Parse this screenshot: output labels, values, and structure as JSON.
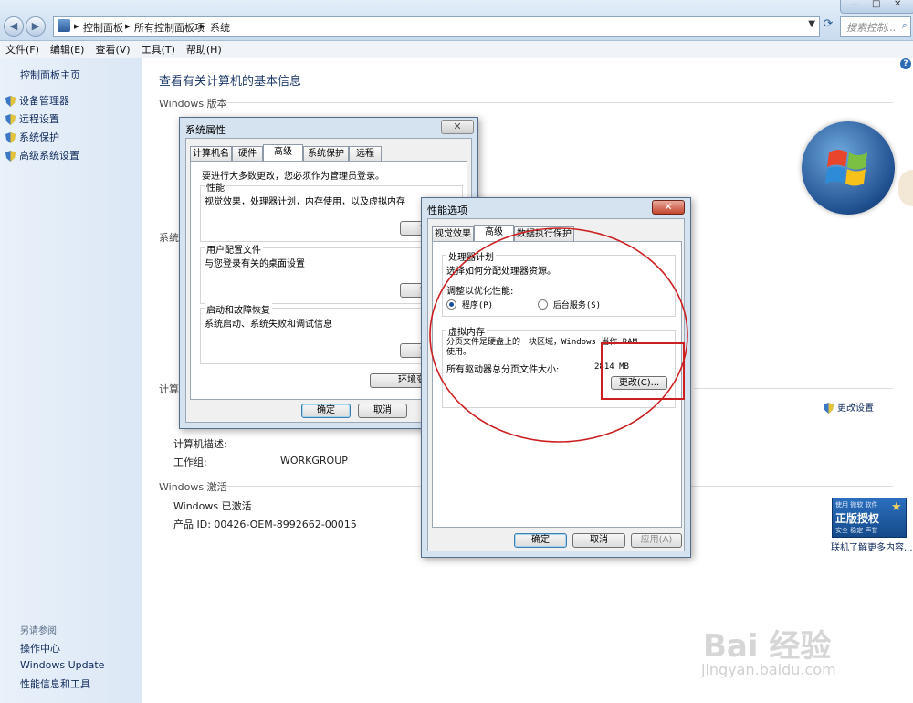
{
  "addressbar": {
    "breadcrumb": [
      "控制面板",
      "所有控制面板项",
      "系统"
    ],
    "separator": "▸",
    "search_placeholder": "搜索控制..."
  },
  "menubar": [
    "文件(F)",
    "编辑(E)",
    "查看(V)",
    "工具(T)",
    "帮助(H)"
  ],
  "sidebar": {
    "home": "控制面板主页",
    "items": [
      {
        "label": "设备管理器",
        "icon": "shield-icon"
      },
      {
        "label": "远程设置",
        "icon": "shield-icon"
      },
      {
        "label": "系统保护",
        "icon": "shield-icon"
      },
      {
        "label": "高级系统设置",
        "icon": "shield-icon"
      }
    ],
    "see_also_header": "另请参阅",
    "see_also": [
      "操作中心",
      "Windows Update",
      "性能信息和工具"
    ]
  },
  "main": {
    "title": "查看有关计算机的基本信息",
    "edition_header": "Windows 版本",
    "system_header": "系统",
    "computer_header": "计算",
    "computer_desc_label": "计算机描述:",
    "workgroup_label": "工作组:",
    "workgroup_value": "WORKGROUP",
    "change_settings": "更改设置",
    "activation_header": "Windows 激活",
    "activated": "Windows 已激活",
    "product_id": "产品 ID: 00426-OEM-8992662-00015",
    "genuine_badge": {
      "line1": "使用 微软 软件",
      "line2": "正版授权",
      "line3": "安全 稳定 声誉"
    },
    "genuine_link": "联机了解更多内容..."
  },
  "sysprops": {
    "title": "系统属性",
    "tabs": [
      "计算机名",
      "硬件",
      "高级",
      "系统保护",
      "远程"
    ],
    "active_tab": "高级",
    "admin_note": "要进行大多数更改，您必须作为管理员登录。",
    "perf_group": "性能",
    "perf_desc": "视觉效果，处理器计划，内存使用，以及虚拟内存",
    "profile_group": "用户配置文件",
    "profile_desc": "与您登录有关的桌面设置",
    "startup_group": "启动和故障恢复",
    "startup_desc": "系统启动、系统失败和调试信息",
    "settings_btn": "设置",
    "env_btn": "环境变量",
    "ok": "确定",
    "cancel": "取消"
  },
  "perfopts": {
    "title": "性能选项",
    "tabs": [
      "视觉效果",
      "高级",
      "数据执行保护"
    ],
    "active_tab": "高级",
    "cpu_group": "处理器计划",
    "cpu_desc": "选择如何分配处理器资源。",
    "adjust_label": "调整以优化性能:",
    "radio_programs": "程序(P)",
    "radio_background": "后台服务(S)",
    "vm_group": "虚拟内存",
    "vm_desc": "分页文件是硬盘上的一块区域，Windows 当作 RAM 使用。",
    "vm_total_label": "所有驱动器总分页文件大小:",
    "vm_total_value": "2814 MB",
    "change_btn": "更改(C)...",
    "ok": "确定",
    "cancel": "取消",
    "apply": "应用(A)"
  },
  "watermark": {
    "brand": "Bai 经验",
    "url": "jingyan.baidu.com"
  },
  "colors": {
    "annotation_red": "#cc1f1f",
    "link_blue": "#0f2a5c"
  }
}
